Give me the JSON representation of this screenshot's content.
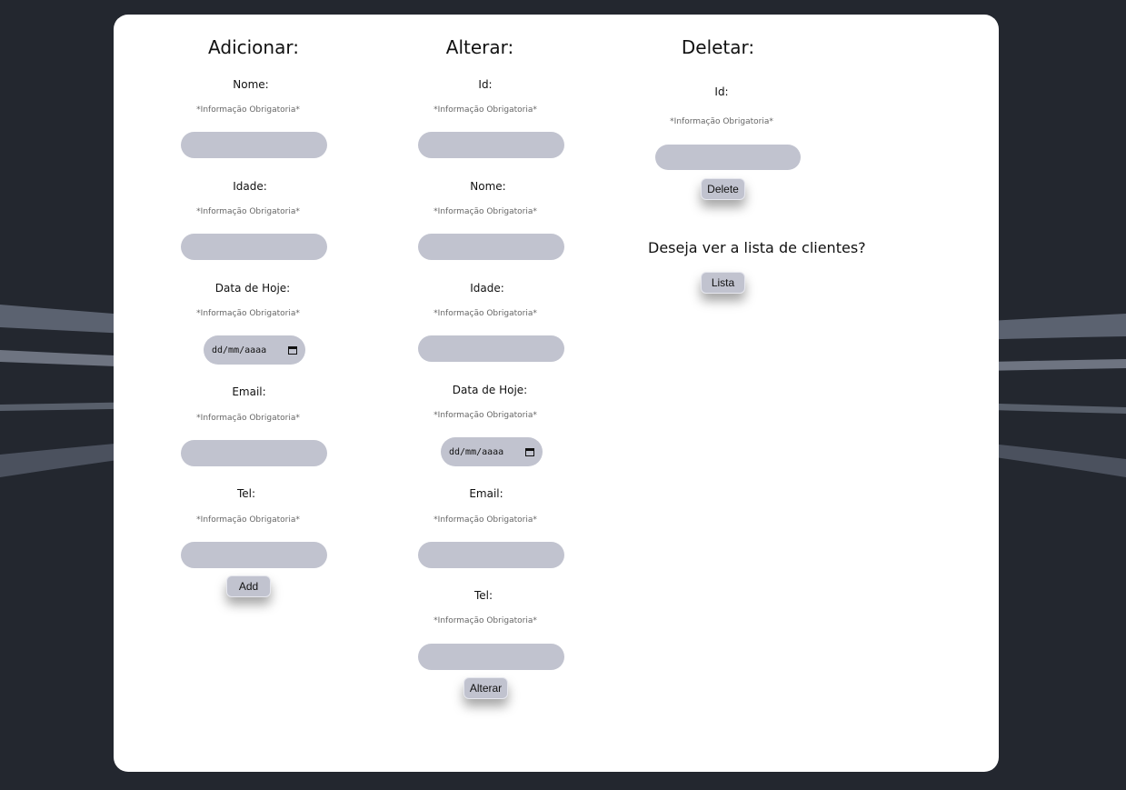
{
  "required_note": "*Informação Obrigatoria*",
  "date_placeholder": "dd/mm/aaaa",
  "add": {
    "title": "Adicionar:",
    "fields": {
      "nome": "Nome:",
      "idade": "Idade:",
      "data": "Data de Hoje:",
      "email": "Email:",
      "tel": "Tel:"
    },
    "button": "Add"
  },
  "alter": {
    "title": "Alterar:",
    "fields": {
      "id": "Id:",
      "nome": "Nome:",
      "idade": "Idade:",
      "data": "Data de Hoje:",
      "email": "Email:",
      "tel": "Tel:"
    },
    "button": "Alterar"
  },
  "delete": {
    "title": "Deletar:",
    "fields": {
      "id": "Id:"
    },
    "button": "Delete"
  },
  "list": {
    "question": "Deseja ver a lista de clientes?",
    "button": "Lista"
  }
}
